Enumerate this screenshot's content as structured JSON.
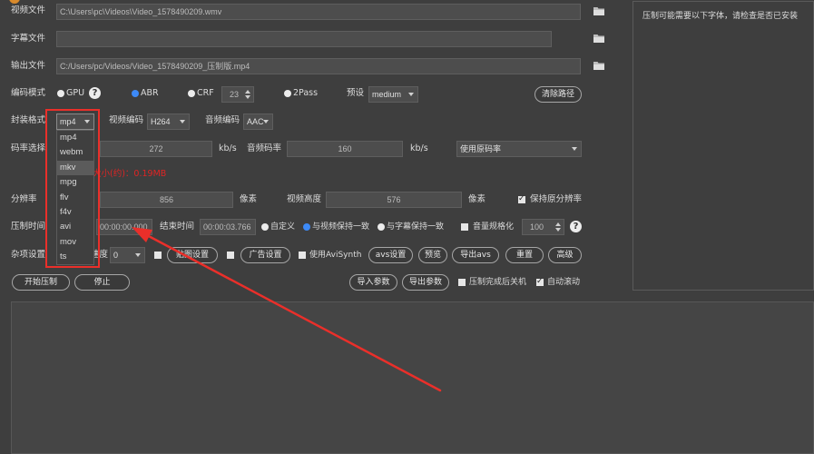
{
  "colors": {
    "background": "#3e3e3e",
    "input": "#4d4d4d",
    "text": "#dcdcdc",
    "accent": "#3d8af7",
    "warning": "#e02424",
    "annotation": "#ea2f2a"
  },
  "icons": {
    "app": "app-icon",
    "folder": "folder-icon",
    "help": "help-icon",
    "dropdown": "chevron-down-icon",
    "spinner": "spinner-arrows-icon"
  },
  "files": {
    "video": {
      "label": "视频文件",
      "value": "C:\\Users\\pc\\Videos\\Video_1578490209.wmv"
    },
    "subtitle": {
      "label": "字幕文件",
      "value": ""
    },
    "output": {
      "label": "输出文件",
      "value": "C:/Users/pc/Videos/Video_1578490209_压制版.mp4"
    }
  },
  "font_panel": {
    "text": "压制可能需要以下字体，请检查是否已安装"
  },
  "encode_mode": {
    "label": "编码模式",
    "gpu": {
      "label": "GPU",
      "on": false
    },
    "abr": {
      "label": "ABR",
      "on": true
    },
    "crf": {
      "label": "CRF",
      "on": false,
      "value": "23"
    },
    "two_pass": {
      "label": "2Pass",
      "on": false
    },
    "preset_label": "预设",
    "preset": "medium",
    "clear_paths_button": "清除路径"
  },
  "format": {
    "container_label": "封装格式",
    "container": "mp4",
    "container_options": [
      {
        "label": "mp4",
        "hover": false
      },
      {
        "label": "webm",
        "hover": false
      },
      {
        "label": "mkv",
        "hover": true
      },
      {
        "label": "mpg",
        "hover": false
      },
      {
        "label": "flv",
        "hover": false
      },
      {
        "label": "f4v",
        "hover": false
      },
      {
        "label": "avi",
        "hover": false
      },
      {
        "label": "mov",
        "hover": false
      },
      {
        "label": "ts",
        "hover": false
      }
    ],
    "video_codec_label": "视频编码",
    "video_codec": "H264",
    "audio_codec_label": "音频编码",
    "audio_codec": "AAC"
  },
  "bitrate": {
    "label": "码率选择",
    "video": "272",
    "video_unit": "kb/s",
    "audio_label": "音频码率",
    "audio": "160",
    "audio_unit": "kb/s",
    "mode": "使用原码率",
    "estimate": "预计文件大小(约)：0.19MB"
  },
  "resolution": {
    "label": "分辨率",
    "width": "856",
    "width_unit": "像素",
    "height_label": "视频高度",
    "height": "576",
    "height_unit": "像素",
    "keep_original": {
      "label": "保持原分辨率",
      "on": true
    }
  },
  "time": {
    "label": "压制时间",
    "start": "00:00:00.000",
    "end_label": "结束时间",
    "end": "00:00:03.766",
    "custom": {
      "label": "自定义",
      "on": false
    },
    "match_video": {
      "label": "与视频保持一致",
      "on": true
    },
    "match_subtitle": {
      "label": "与字幕保持一致",
      "on": false
    },
    "normalize": {
      "label": "音量规格化",
      "on": false,
      "value": "100"
    }
  },
  "misc": {
    "label": "杂项设置",
    "speed_label": "速度",
    "speed": "0",
    "watermark": {
      "on": false,
      "button": "贴图设置"
    },
    "ad": {
      "on": false,
      "button": "广告设置"
    },
    "avisynth": {
      "on": false,
      "label": "使用AviSynth"
    },
    "avs_settings": "avs设置",
    "preview": "预览",
    "export_avs": "导出avs",
    "reset": "重置",
    "advanced": "高级"
  },
  "actions": {
    "start": "开始压制",
    "stop": "停止",
    "import_params": "导入参数",
    "export_params": "导出参数",
    "shutdown": {
      "label": "压制完成后关机",
      "on": false
    },
    "auto_scroll": {
      "label": "自动滚动",
      "on": true
    }
  },
  "log": {
    "text": ""
  }
}
